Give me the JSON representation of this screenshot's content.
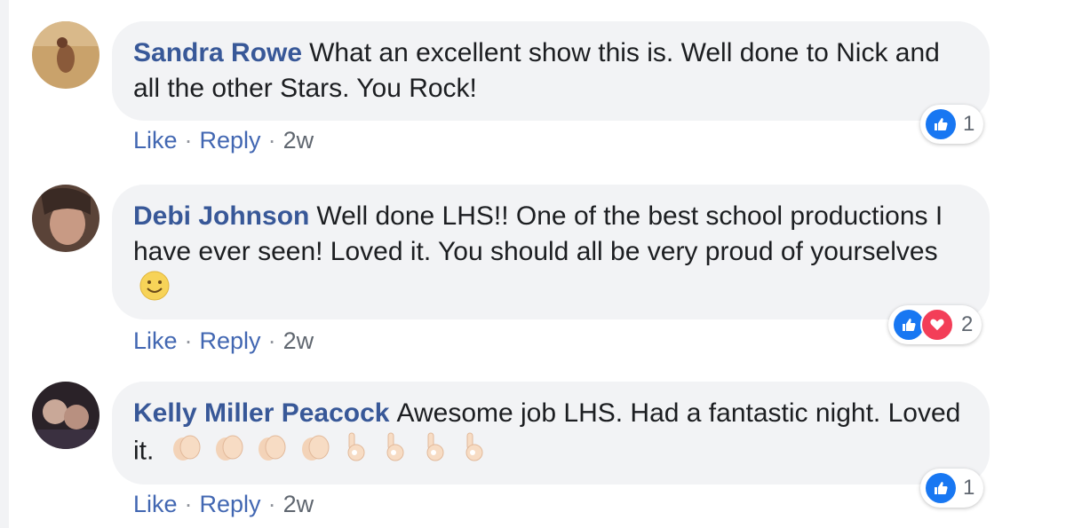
{
  "colors": {
    "author": "#385898",
    "link": "#4267b2",
    "bubble": "#f2f3f5",
    "like": "#1877f2",
    "love": "#f33e58"
  },
  "comments": [
    {
      "author": "Sandra Rowe",
      "text": "What an excellent show this is. Well done to Nick and all the other Stars. You Rock!",
      "actions": {
        "like": "Like",
        "reply": "Reply",
        "time": "2w"
      },
      "reactions": {
        "icons": [
          "like-icon"
        ],
        "count": "1"
      }
    },
    {
      "author": "Debi Johnson",
      "text": "Well done LHS!! One of the best school productions I have ever seen! Loved it. You should all be very proud of yourselves",
      "emoji": [
        "smiley-emoji"
      ],
      "actions": {
        "like": "Like",
        "reply": "Reply",
        "time": "2w"
      },
      "reactions": {
        "icons": [
          "like-icon",
          "love-icon"
        ],
        "count": "2"
      }
    },
    {
      "author": "Kelly Miller Peacock",
      "text": "Awesome job LHS. Had a fantastic night. Loved it.",
      "emoji": [
        "clap-emoji",
        "clap-emoji",
        "clap-emoji",
        "clap-emoji",
        "ok-hand-emoji",
        "ok-hand-emoji",
        "ok-hand-emoji",
        "ok-hand-emoji"
      ],
      "actions": {
        "like": "Like",
        "reply": "Reply",
        "time": "2w"
      },
      "reactions": {
        "icons": [
          "like-icon"
        ],
        "count": "1"
      }
    }
  ]
}
